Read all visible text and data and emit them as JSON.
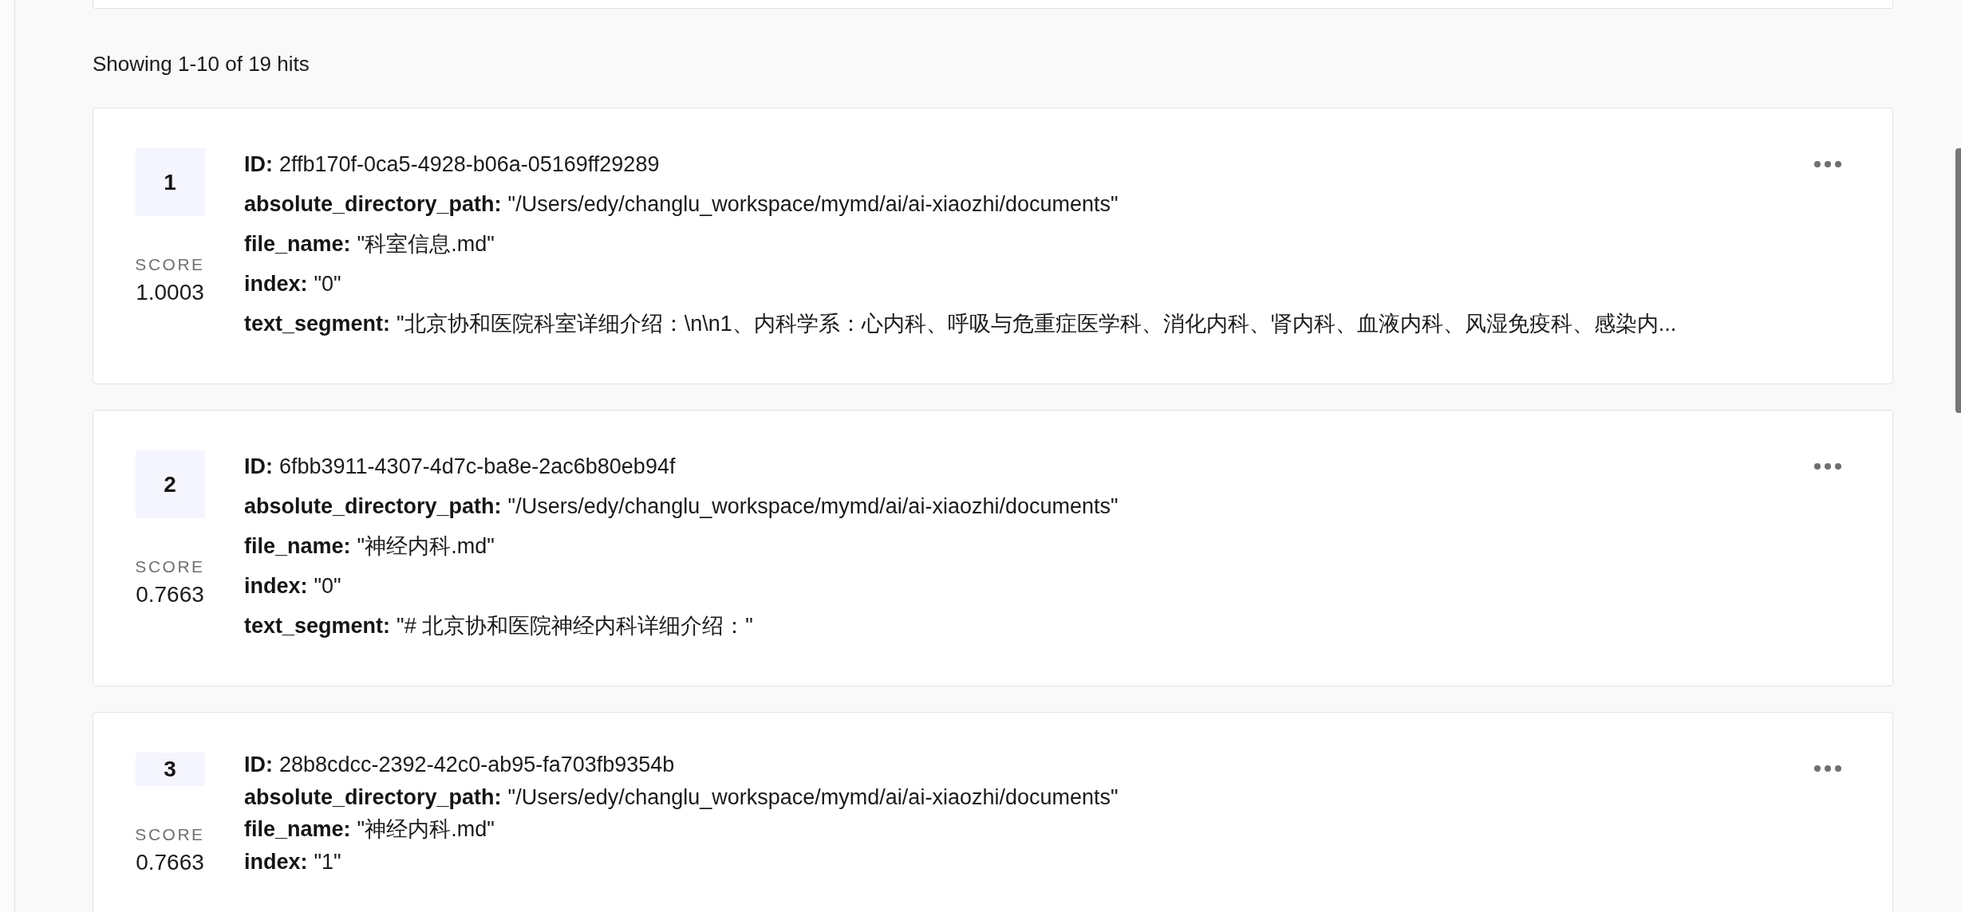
{
  "results_summary": "Showing 1-10 of 19 hits",
  "hits": [
    {
      "rank": "1",
      "score_label": "SCORE",
      "score": "1.0003",
      "fields": [
        {
          "label": "ID:",
          "value": "2ffb170f-0ca5-4928-b06a-05169ff29289"
        },
        {
          "label": "absolute_directory_path:",
          "value": "\"/Users/edy/changlu_workspace/mymd/ai/ai-xiaozhi/documents\""
        },
        {
          "label": "file_name:",
          "value": "\"科室信息.md\""
        },
        {
          "label": "index:",
          "value": "\"0\""
        },
        {
          "label": "text_segment:",
          "value": "\"北京协和医院科室详细介绍：\\n\\n1、内科学系：心内科、呼吸与危重症医学科、消化内科、肾内科、血液内科、风湿免疫科、感染内..."
        }
      ]
    },
    {
      "rank": "2",
      "score_label": "SCORE",
      "score": "0.7663",
      "fields": [
        {
          "label": "ID:",
          "value": "6fbb3911-4307-4d7c-ba8e-2ac6b80eb94f"
        },
        {
          "label": "absolute_directory_path:",
          "value": "\"/Users/edy/changlu_workspace/mymd/ai/ai-xiaozhi/documents\""
        },
        {
          "label": "file_name:",
          "value": "\"神经内科.md\""
        },
        {
          "label": "index:",
          "value": "\"0\""
        },
        {
          "label": "text_segment:",
          "value": "\"# 北京协和医院神经内科详细介绍：\""
        }
      ]
    },
    {
      "rank": "3",
      "score_label": "SCORE",
      "score": "0.7663",
      "fields": [
        {
          "label": "ID:",
          "value": "28b8cdcc-2392-42c0-ab95-fa703fb9354b"
        },
        {
          "label": "absolute_directory_path:",
          "value": "\"/Users/edy/changlu_workspace/mymd/ai/ai-xiaozhi/documents\""
        },
        {
          "label": "file_name:",
          "value": "\"神经内科.md\""
        },
        {
          "label": "index:",
          "value": "\"1\""
        }
      ]
    }
  ]
}
